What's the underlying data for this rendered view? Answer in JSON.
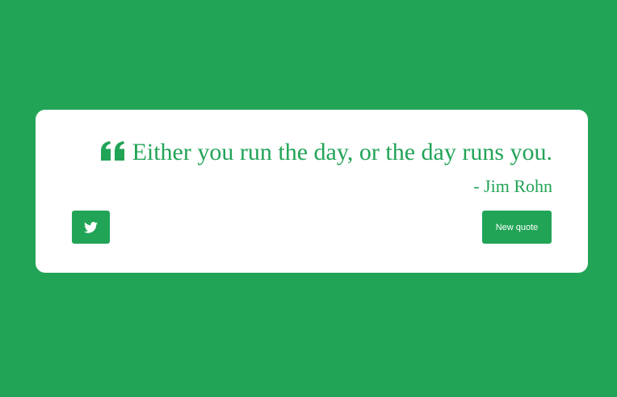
{
  "colors": {
    "background": "#22a457",
    "card": "#ffffff",
    "accent": "#22a457",
    "button_text": "#ffffff"
  },
  "quote": {
    "icon": "quote-left-icon",
    "text": "Either you run the day, or the day runs you.",
    "author": "- Jim Rohn"
  },
  "actions": {
    "tweet_icon": "twitter-icon",
    "new_quote_label": "New quote"
  }
}
